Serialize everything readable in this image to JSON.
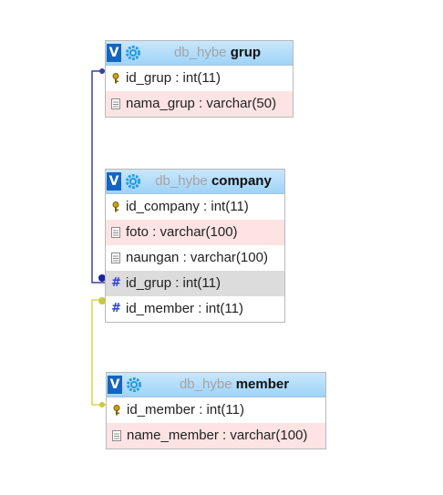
{
  "tables": {
    "grup": {
      "db": "db_hybe",
      "name": "grup",
      "columns": [
        {
          "label": "id_grup : int(11)",
          "icon": "primary-key-icon"
        },
        {
          "label": "nama_grup : varchar(50)",
          "icon": "column-icon"
        }
      ]
    },
    "company": {
      "db": "db_hybe",
      "name": "company",
      "columns": [
        {
          "label": "id_company : int(11)",
          "icon": "primary-key-icon"
        },
        {
          "label": "foto : varchar(100)",
          "icon": "column-icon"
        },
        {
          "label": "naungan : varchar(100)",
          "icon": "column-icon"
        },
        {
          "label": "id_grup : int(11)",
          "icon": "foreign-key-icon"
        },
        {
          "label": "id_member : int(11)",
          "icon": "foreign-key-icon"
        }
      ]
    },
    "member": {
      "db": "db_hybe",
      "name": "member",
      "columns": [
        {
          "label": "id_member : int(11)",
          "icon": "primary-key-icon"
        },
        {
          "label": "name_member : varchar(100)",
          "icon": "column-icon"
        }
      ]
    }
  },
  "toggle_label": "V",
  "colors": {
    "header_top": "#c9e7fb",
    "header_bottom": "#9fd3f7",
    "row_highlight": "#fde3e3",
    "row_selected": "#dcdcdc",
    "relation_grup": "#3b3fa8",
    "relation_member": "#d8d84a"
  }
}
